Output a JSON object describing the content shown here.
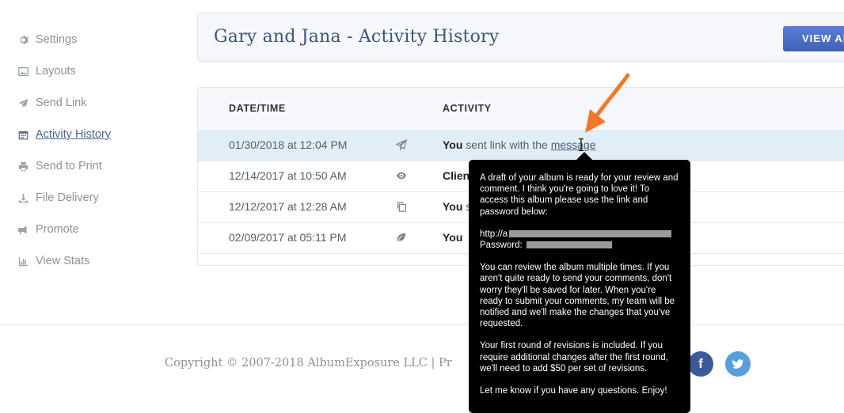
{
  "sidebar": {
    "items": [
      {
        "label": "Settings",
        "icon": "gear-icon"
      },
      {
        "label": "Layouts",
        "icon": "image-icon"
      },
      {
        "label": "Send Link",
        "icon": "paper-plane-icon"
      },
      {
        "label": "Activity History",
        "icon": "calendar-icon",
        "active": true
      },
      {
        "label": "Send to Print",
        "icon": "printer-icon"
      },
      {
        "label": "File Delivery",
        "icon": "download-icon"
      },
      {
        "label": "Promote",
        "icon": "megaphone-icon"
      },
      {
        "label": "View Stats",
        "icon": "bar-chart-icon"
      }
    ]
  },
  "header": {
    "title": "Gary and Jana - Activity History",
    "view_button": "VIEW AL"
  },
  "table": {
    "columns": {
      "date": "DATE/TIME",
      "activity": "ACTIVITY"
    },
    "rows": [
      {
        "date": "01/30/2018 at 12:04 PM",
        "icon": "paper-plane-icon",
        "actor": "You",
        "text": "sent link with the ",
        "link": "message"
      },
      {
        "date": "12/14/2017 at 10:50 AM",
        "icon": "eye-icon",
        "actor": "Clien",
        "text": "",
        "link": ""
      },
      {
        "date": "12/12/2017 at 12:28 AM",
        "icon": "copy-icon",
        "actor": "You",
        "text": " s",
        "link": ""
      },
      {
        "date": "02/09/2017 at 05:11 PM",
        "icon": "leaf-icon",
        "actor": "You",
        "text": "",
        "link": ""
      }
    ]
  },
  "tooltip": {
    "p1": "A draft of your album is ready for your review and comment. I think you're going to love it! To access this album please use the link and password below:",
    "url_label": "http://a",
    "password_label": "Password: ",
    "p2": "You can review the album multiple times. If you aren't quite ready to send your comments, don't worry they'll be saved for later. When you're ready to submit your comments, my team will be notified and we'll make the changes that you've requested.",
    "p3": "Your first round of revisions is included. If you require additional changes after the first round, we'll need to add $50 per set of revisions.",
    "p4": "Let me know if you have any questions. Enjoy!"
  },
  "footer": {
    "copyright": "Copyright © 2007-2018 AlbumExposure LLC  | Pr",
    "facebook": "f",
    "twitter": "t"
  },
  "colors": {
    "accent": "#3e62b6",
    "highlight_row": "#e2eef7",
    "arrow": "#f07a2a",
    "tooltip_bg": "#000000"
  }
}
